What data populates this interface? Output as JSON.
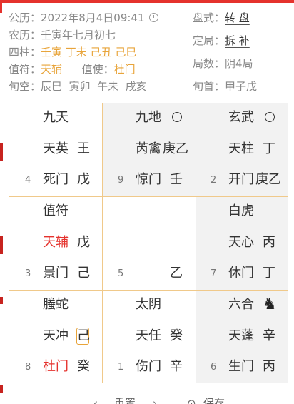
{
  "header": {
    "gongli_label": "公历：",
    "gongli_value": "2022年8月4日09:41",
    "nongli_label": "农历：",
    "nongli_value": "壬寅年七月初七",
    "sizhu_label": "四柱：",
    "sizhu_value": "壬寅 丁未 己丑 己巳",
    "zhifu_label": "值符：",
    "zhifu_value": "天辅",
    "zhishi_label": "值使：",
    "zhishi_value": "杜门",
    "xunkong_label": "旬空：",
    "xunkong_value": "辰巳  寅卯  午未  戌亥",
    "panshi_label": "盘式：",
    "panshi_value": "转 盘",
    "dingju_label": "定局：",
    "dingju_value": "拆 补",
    "jushu_label": "局数：",
    "jushu_value": "阴4局",
    "xunshou_label": "旬首：",
    "xunshou_value": "甲子戊"
  },
  "palaces": [
    {
      "god": "九天",
      "star": "天英",
      "star_stem": "王",
      "num": "4",
      "door": "死门",
      "door_stem": "戊"
    },
    {
      "god": "九地",
      "star": "芮禽",
      "star_stem": "庚乙",
      "num": "9",
      "door": "惊门",
      "door_stem": "壬"
    },
    {
      "god": "玄武",
      "star": "天柱",
      "star_stem": "丁",
      "num": "2",
      "door": "开门",
      "door_stem": "庚乙"
    },
    {
      "god": "值符",
      "star": "天辅",
      "star_stem": "戊",
      "num": "3",
      "door": "景门",
      "door_stem": "己"
    },
    {
      "god": "",
      "star": "",
      "star_stem": "",
      "num": "5",
      "door": "",
      "door_stem": "乙"
    },
    {
      "god": "白虎",
      "star": "天心",
      "star_stem": "丙",
      "num": "7",
      "door": "休门",
      "door_stem": "丁"
    },
    {
      "god": "螣蛇",
      "star": "天冲",
      "star_stem": "己",
      "num": "8",
      "door": "杜门",
      "door_stem": "癸"
    },
    {
      "god": "太阴",
      "star": "天任",
      "star_stem": "癸",
      "num": "1",
      "door": "伤门",
      "door_stem": "辛"
    },
    {
      "god": "六合",
      "star": "天蓬",
      "star_stem": "辛",
      "num": "6",
      "door": "生门",
      "door_stem": "丙"
    }
  ],
  "bottom": {
    "prev_label": "重置",
    "save_label": "保存"
  },
  "colors": {
    "accent_red": "#e5322d",
    "accent_gold": "#e8a43a",
    "grid_border": "#f0c98a",
    "shade": "#f2f2f2"
  }
}
